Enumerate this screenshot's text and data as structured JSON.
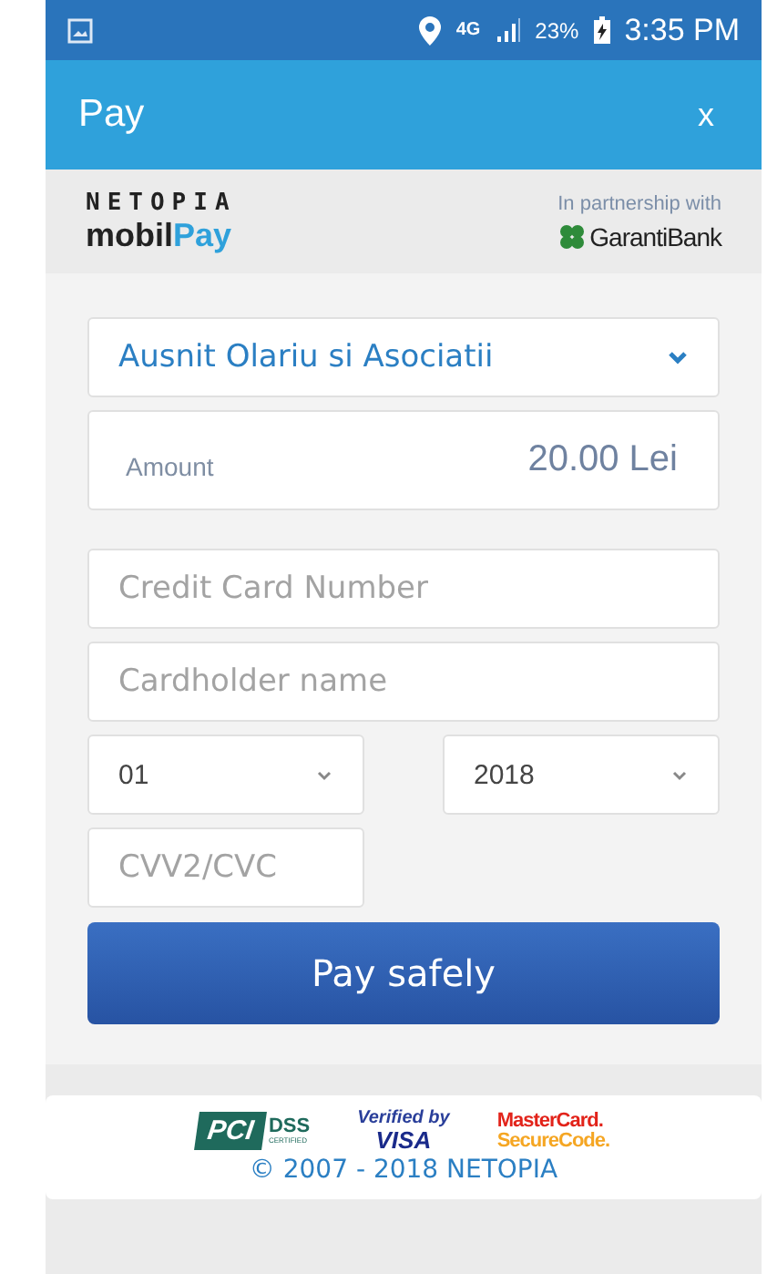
{
  "status_bar": {
    "network": "4G",
    "battery": "23%",
    "time": "3:35 PM"
  },
  "app_bar": {
    "title": "Pay",
    "close": "x"
  },
  "brand": {
    "logo_top": "NETOPIA",
    "logo_left": "mobil",
    "logo_right": "Pay",
    "partner_label": "In partnership with",
    "partner": "GarantiBank"
  },
  "form": {
    "merchant": "Ausnit Olariu si Asociatii",
    "amount_label": "Amount",
    "amount": "20.00 Lei",
    "card_number": {
      "placeholder": "Credit Card Number"
    },
    "cardholder": {
      "placeholder": "Cardholder name"
    },
    "month": "01",
    "year": "2018",
    "cvv": {
      "placeholder": "CVV2/CVC"
    },
    "submit": "Pay safely"
  },
  "footer": {
    "pci": "PCI",
    "dss": "DSS",
    "certified": "CERTIFIED",
    "verified": "Verified by",
    "visa": "VISA",
    "mastercard": "MasterCard.",
    "securecode": "SecureCode.",
    "copyright": "© 2007 - 2018 NETOPIA"
  }
}
